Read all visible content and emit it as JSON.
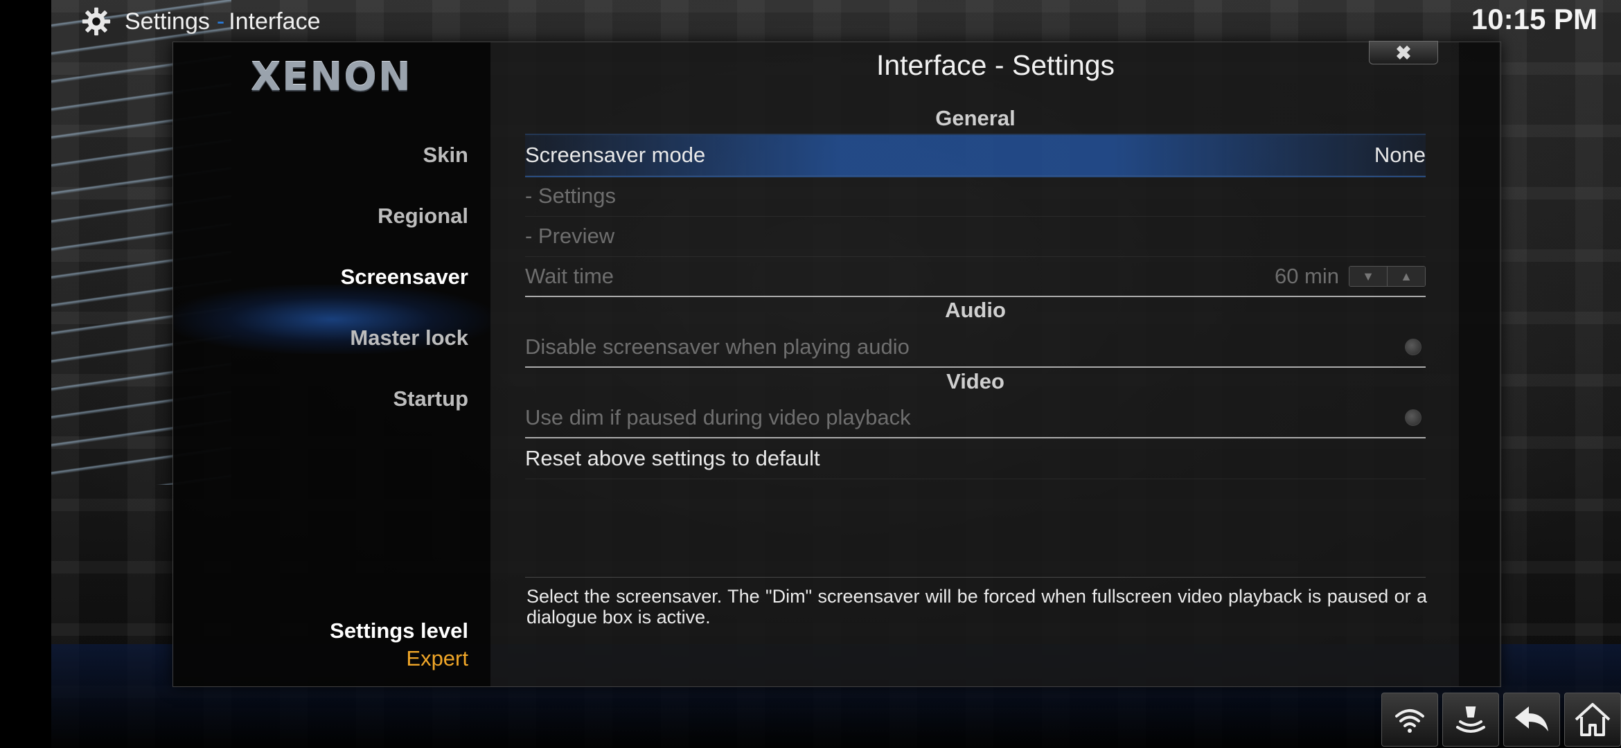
{
  "header": {
    "section": "Settings",
    "separator": "-",
    "page": "Interface",
    "clock": "10:15 PM",
    "gear_icon": "gear-icon"
  },
  "dialog": {
    "logo_text": "XENON",
    "title": "Interface - Settings",
    "close_label": "✖"
  },
  "sidebar": {
    "items": [
      {
        "label": "Skin",
        "active": false
      },
      {
        "label": "Regional",
        "active": false
      },
      {
        "label": "Screensaver",
        "active": true
      },
      {
        "label": "Master lock",
        "active": false
      },
      {
        "label": "Startup",
        "active": false
      }
    ],
    "settings_level_label": "Settings level",
    "settings_level_value": "Expert"
  },
  "sections": {
    "general": "General",
    "audio": "Audio",
    "video": "Video"
  },
  "settings": {
    "screensaver_mode": {
      "label": "Screensaver mode",
      "value": "None"
    },
    "settings": {
      "label": "- Settings"
    },
    "preview": {
      "label": "- Preview"
    },
    "wait_time": {
      "label": "Wait time",
      "value": "60 min"
    },
    "disable_audio": {
      "label": "Disable screensaver when playing audio"
    },
    "use_dim": {
      "label": "Use dim if paused during video playback"
    },
    "reset": {
      "label": "Reset above settings to default"
    }
  },
  "description": "Select the screensaver. The \"Dim\" screensaver will be forced when fullscreen video playback is paused or a dialogue box is active.",
  "bottom_buttons": [
    "wifi-icon",
    "sound-waves-icon",
    "back-arrow-icon",
    "home-icon"
  ],
  "colors": {
    "accent_blue": "#2a7fe0",
    "level_orange": "#f0a628"
  }
}
